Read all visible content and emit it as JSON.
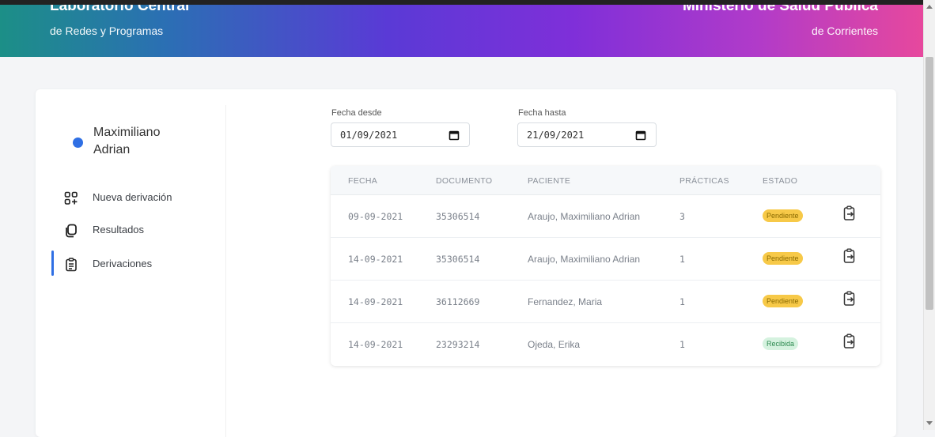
{
  "header": {
    "left_title": "Laboratorio Central",
    "left_subtitle": "de Redes y Programas",
    "right_title": "Ministerio de Salud Publica",
    "right_subtitle": "de Corrientes"
  },
  "sidebar": {
    "user_name": "Maximiliano Adrian",
    "items": [
      {
        "label": "Nueva derivación",
        "icon": "grid-plus-icon"
      },
      {
        "label": "Resultados",
        "icon": "copy-icon"
      },
      {
        "label": "Derivaciones",
        "icon": "clipboard-list-icon",
        "active": true
      }
    ]
  },
  "filters": {
    "from_label": "Fecha desde",
    "from_value": "01/09/2021",
    "to_label": "Fecha hasta",
    "to_value": "21/09/2021"
  },
  "table": {
    "headers": [
      "FECHA",
      "DOCUMENTO",
      "PACIENTE",
      "PRÁCTICAS",
      "ESTADO"
    ],
    "rows": [
      {
        "fecha": "09-09-2021",
        "documento": "35306514",
        "paciente": "Araujo, Maximiliano Adrian",
        "practicas": "3",
        "estado": "Pendiente"
      },
      {
        "fecha": "14-09-2021",
        "documento": "35306514",
        "paciente": "Araujo, Maximiliano Adrian",
        "practicas": "1",
        "estado": "Pendiente"
      },
      {
        "fecha": "14-09-2021",
        "documento": "36112669",
        "paciente": "Fernandez, Maria",
        "practicas": "1",
        "estado": "Pendiente"
      },
      {
        "fecha": "14-09-2021",
        "documento": "23293214",
        "paciente": "Ojeda, Erika",
        "practicas": "1",
        "estado": "Recibida"
      }
    ]
  },
  "colors": {
    "accent": "#2f6fe4",
    "pending": "#f7c948",
    "received": "#d5f2df"
  }
}
